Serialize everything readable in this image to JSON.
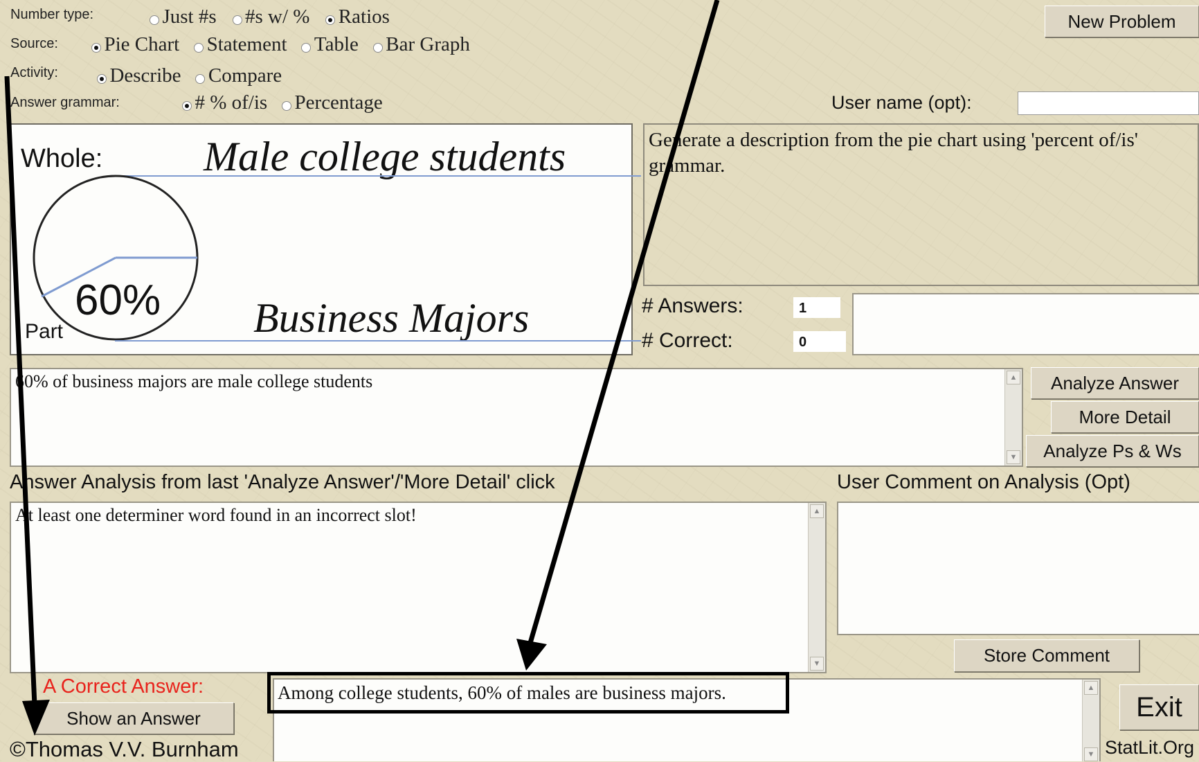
{
  "settings": {
    "number_type": {
      "label": "Number type:",
      "options": [
        "Just #s",
        "#s w/ %",
        "Ratios"
      ],
      "selected": "Ratios"
    },
    "source": {
      "label": "Source:",
      "options": [
        "Pie Chart",
        "Statement",
        "Table",
        "Bar Graph"
      ],
      "selected": "Pie Chart"
    },
    "activity": {
      "label": "Activity:",
      "options": [
        "Describe",
        "Compare"
      ],
      "selected": "Describe"
    },
    "answer_grammar": {
      "label": "Answer grammar:",
      "options": [
        "# % of/is",
        "Percentage"
      ],
      "selected": "# % of/is"
    }
  },
  "buttons": {
    "new_problem": "New Problem",
    "analyze_answer": "Analyze Answer",
    "more_detail": "More Detail",
    "analyze_ps_ws": "Analyze Ps & Ws",
    "store_comment": "Store Comment",
    "show_answer": "Show an Answer",
    "exit": "Exit"
  },
  "user_name": {
    "label": "User name (opt):",
    "value": ""
  },
  "pie": {
    "whole_label": "Whole:",
    "whole_value": "Male college students",
    "part_label": "Part",
    "part_value": "Business Majors",
    "percent": "60%"
  },
  "instructions": "Generate a description from the pie chart using 'percent of/is' grammar.",
  "stats": {
    "answers_label": "# Answers:",
    "answers_value": "1",
    "correct_label": "# Correct:",
    "correct_value": "0"
  },
  "user_answer": "60% of business majors are male college students",
  "analysis": {
    "heading": "Answer Analysis from last 'Analyze Answer'/'More Detail' click",
    "text": "At least one determiner word found in an incorrect slot!"
  },
  "comment": {
    "heading": "User Comment on Analysis (Opt)",
    "value": ""
  },
  "correct_answer": {
    "label": "A Correct Answer:",
    "text": "Among college students, 60% of males are business majors."
  },
  "footer": {
    "copyright": "©Thomas V.V. Burnham",
    "site": "StatLit.Org"
  },
  "colors": {
    "accent_red": "#e8231c",
    "background": "#e3dcc0",
    "pie_line": "#7f9bd0"
  }
}
